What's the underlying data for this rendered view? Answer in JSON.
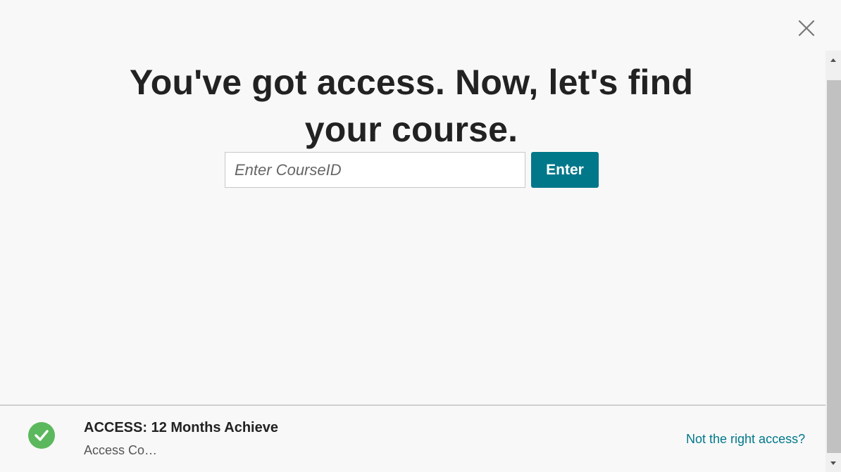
{
  "header": {
    "close_icon": "close-icon"
  },
  "main": {
    "title": "You've got access. Now, let's find your course.",
    "course_input": {
      "placeholder": "Enter CourseID",
      "value": ""
    },
    "enter_label": "Enter"
  },
  "footer": {
    "status_icon": "check-circle-icon",
    "status_color": "#5cb85c",
    "access_title": "ACCESS: 12 Months Achieve",
    "access_subtitle": "Access Co…",
    "not_right_link": "Not the right access?"
  },
  "colors": {
    "accent": "#00788a",
    "background": "#f8f8f8"
  }
}
